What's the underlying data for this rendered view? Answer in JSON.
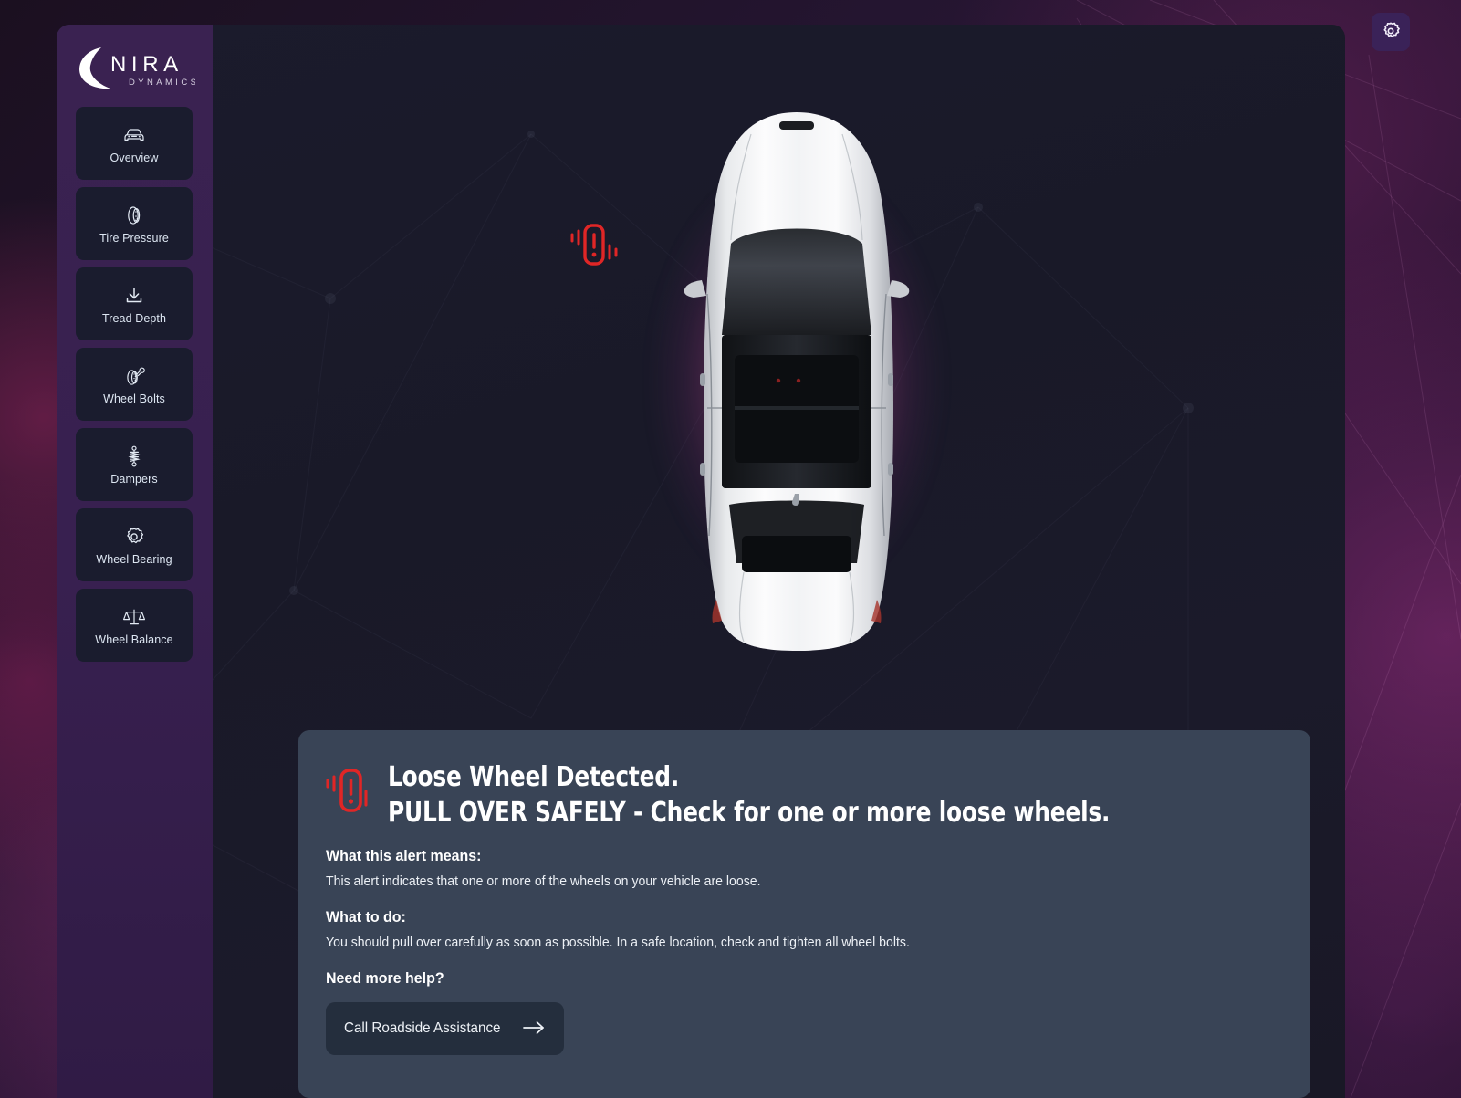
{
  "brand": {
    "name": "NIRA",
    "tagline": "DYNAMICS",
    "logo_icon": "nira-crescent-logo"
  },
  "topbar": {
    "settings_icon": "gear-icon",
    "settings_label": "Settings"
  },
  "sidebar": {
    "items": [
      {
        "label": "Overview",
        "icon": "car-front-icon",
        "active": false
      },
      {
        "label": "Tire Pressure",
        "icon": "tire-icon",
        "active": false
      },
      {
        "label": "Tread Depth",
        "icon": "download-arrow-icon",
        "active": false
      },
      {
        "label": "Wheel Bolts",
        "icon": "tire-wrench-icon",
        "active": false
      },
      {
        "label": "Dampers",
        "icon": "spring-damper-icon",
        "active": false
      },
      {
        "label": "Wheel Bearing",
        "icon": "gear-icon",
        "active": false
      },
      {
        "label": "Wheel Balance",
        "icon": "balance-scale-icon",
        "active": false
      }
    ]
  },
  "stage": {
    "vehicle_icon": "car-top-view",
    "vehicle_glow_color": "#ee78aa",
    "marker": {
      "icon": "loose-wheel-warning-icon",
      "color": "#e02626",
      "position": "front-left-wheel"
    }
  },
  "alert": {
    "icon": "loose-wheel-warning-icon",
    "icon_color": "#e02626",
    "title_line1": "Loose Wheel Detected.",
    "title_line2": "PULL OVER SAFELY - Check for one or more loose wheels.",
    "means_heading": "What this alert means:",
    "means_body": "This alert indicates that one or more of the wheels on your vehicle are loose.",
    "todo_heading": "What to do:",
    "todo_body": "You should pull over carefully as soon as possible. In a safe location, check and tighten all wheel bolts.",
    "help_heading": "Need more help?",
    "cta_label": "Call Roadside Assistance",
    "cta_icon": "arrow-right-icon",
    "panel_color": "#394456"
  }
}
